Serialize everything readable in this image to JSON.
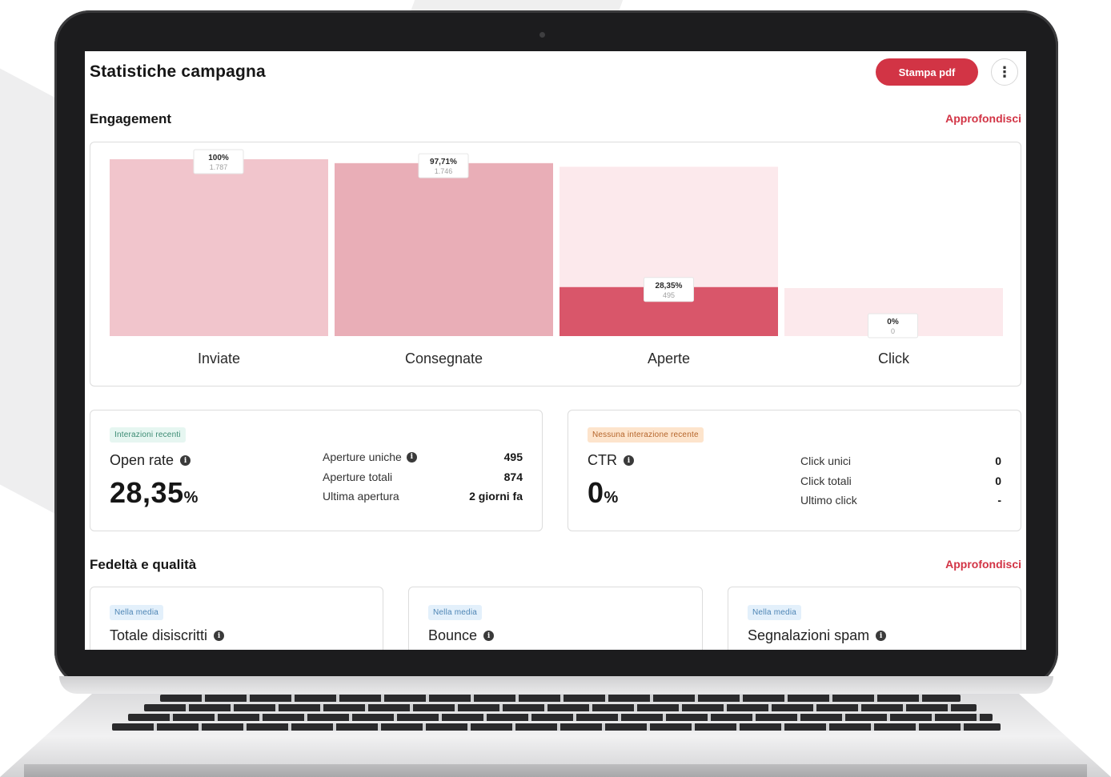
{
  "header": {
    "title": "Statistiche campagna",
    "print_pdf_label": "Stampa pdf",
    "more_icon": "vertical-ellipsis-icon"
  },
  "engagement": {
    "title": "Engagement",
    "link": "Approfondisci"
  },
  "chart_data": {
    "type": "bar",
    "categories": [
      "Inviate",
      "Consegnate",
      "Aperte",
      "Click"
    ],
    "values": [
      1787,
      1746,
      495,
      0
    ],
    "percent_labels": [
      "100%",
      "97,71%",
      "28,35%",
      "0%"
    ],
    "count_labels": [
      "1.787",
      "1.746",
      "495",
      "0"
    ],
    "ylim": [
      0,
      1787
    ],
    "grid": false,
    "colors": [
      "#f1c5cc",
      "#e9aeb7",
      "#d9566a",
      "#fbe6ea"
    ],
    "background_color": "#fce9ec"
  },
  "opens": {
    "badge": "Interazioni recenti",
    "metric": "Open rate",
    "value": "28,35",
    "unit": "%",
    "rows": [
      {
        "label": "Aperture uniche",
        "value": "495"
      },
      {
        "label": "Aperture totali",
        "value": "874"
      },
      {
        "label": "Ultima apertura",
        "value": "2 giorni fa"
      }
    ]
  },
  "clicks": {
    "badge": "Nessuna interazione recente",
    "metric": "CTR",
    "value": "0",
    "unit": "%",
    "rows": [
      {
        "label": "Click unici",
        "value": "0"
      },
      {
        "label": "Click totali",
        "value": "0"
      },
      {
        "label": "Ultimo click",
        "value": "-"
      }
    ]
  },
  "quality": {
    "title": "Fedeltà e qualità",
    "link": "Approfondisci",
    "cards": [
      {
        "badge": "Nella media",
        "metric": "Totale disiscritti"
      },
      {
        "badge": "Nella media",
        "metric": "Bounce"
      },
      {
        "badge": "Nella media",
        "metric": "Segnalazioni spam"
      }
    ]
  },
  "colors": {
    "accent": "#d23445",
    "info_icon": "i"
  }
}
